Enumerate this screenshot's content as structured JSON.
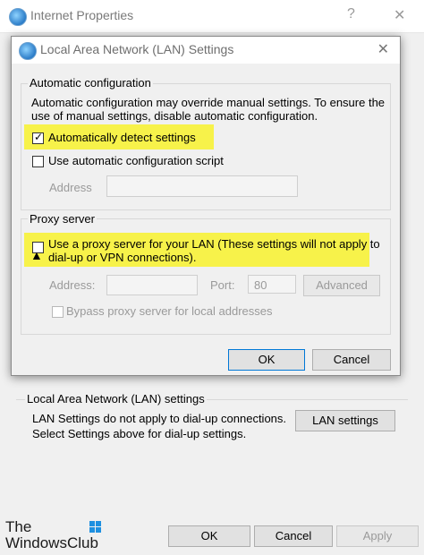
{
  "outer_window": {
    "title": "Internet Properties",
    "help_glyph": "?",
    "close_glyph": "✕",
    "lan_group_label": "Local Area Network (LAN) settings",
    "lan_note_line1": "LAN Settings do not apply to dial-up connections.",
    "lan_note_line2": "Select Settings above for dial-up settings.",
    "lan_settings_button": "LAN settings",
    "ok_button": "OK",
    "cancel_button": "Cancel",
    "apply_button": "Apply"
  },
  "dialog": {
    "title": "Local Area Network (LAN) Settings",
    "close_glyph": "✕",
    "auto_config": {
      "group_label": "Automatic configuration",
      "description_line1": "Automatic configuration may override manual settings.  To ensure the",
      "description_line2": "use of manual settings, disable automatic configuration.",
      "auto_detect_label": "Automatically detect settings",
      "auto_detect_checked": true,
      "auto_detect_mark": "✓",
      "use_script_label": "Use automatic configuration script",
      "use_script_checked": false,
      "address_label": "Address",
      "address_value": ""
    },
    "proxy": {
      "group_label": "Proxy server",
      "use_proxy_line1": "Use a proxy server for your LAN (These settings will not apply to",
      "use_proxy_line2": "dial-up or VPN connections).",
      "use_proxy_checked": false,
      "address_label": "Address:",
      "address_value": "",
      "port_label": "Port:",
      "port_value": "80",
      "advanced_button": "Advanced",
      "bypass_label": "Bypass proxy server for local addresses",
      "bypass_checked": false
    },
    "ok_button": "OK",
    "cancel_button": "Cancel"
  },
  "watermark": {
    "line1": "The",
    "line2": "WindowsClub"
  },
  "colors": {
    "highlight": "#f7f24a",
    "accent": "#0078d7",
    "logo_blue": "#1e90e0"
  }
}
